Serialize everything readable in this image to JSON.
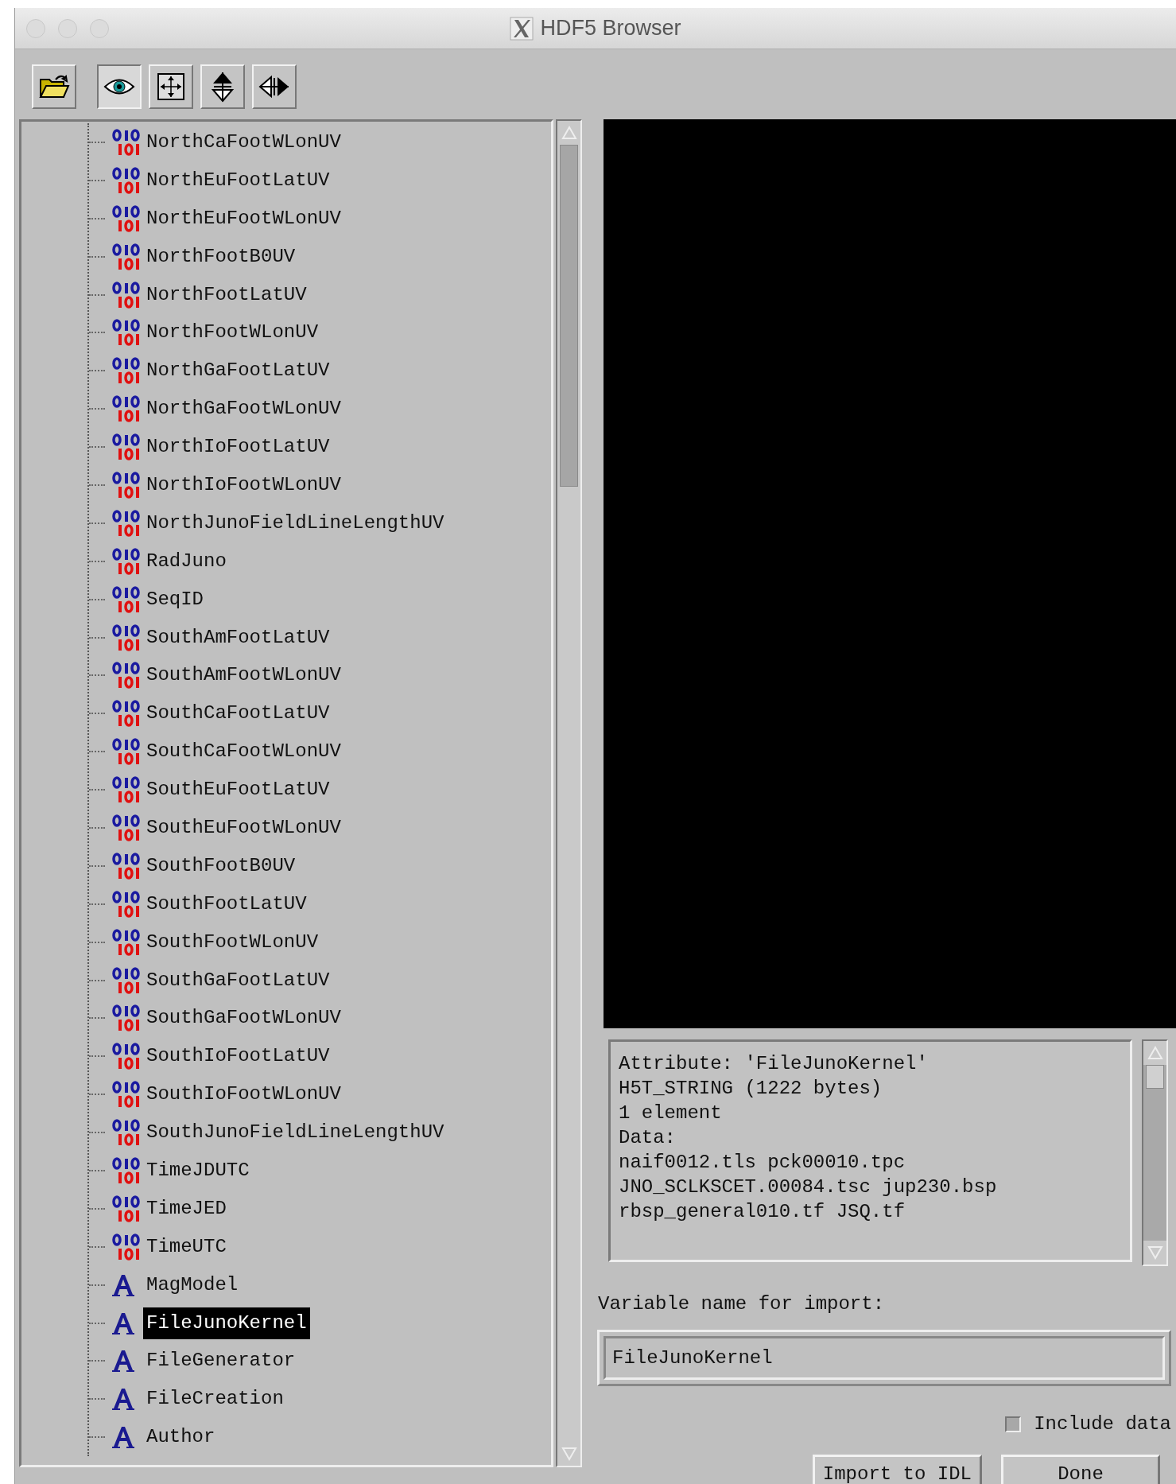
{
  "window": {
    "title": "HDF5 Browser"
  },
  "toolbar": [
    {
      "kind": "open",
      "selected": false
    },
    {
      "kind": "eye",
      "selected": true
    },
    {
      "kind": "fit",
      "selected": false
    },
    {
      "kind": "updown",
      "selected": false
    },
    {
      "kind": "leftright",
      "selected": false
    }
  ],
  "tree": {
    "items": [
      {
        "kind": "dataset",
        "label": "NorthCaFootWLonUV",
        "selected": false
      },
      {
        "kind": "dataset",
        "label": "NorthEuFootLatUV",
        "selected": false
      },
      {
        "kind": "dataset",
        "label": "NorthEuFootWLonUV",
        "selected": false
      },
      {
        "kind": "dataset",
        "label": "NorthFootB0UV",
        "selected": false
      },
      {
        "kind": "dataset",
        "label": "NorthFootLatUV",
        "selected": false
      },
      {
        "kind": "dataset",
        "label": "NorthFootWLonUV",
        "selected": false
      },
      {
        "kind": "dataset",
        "label": "NorthGaFootLatUV",
        "selected": false
      },
      {
        "kind": "dataset",
        "label": "NorthGaFootWLonUV",
        "selected": false
      },
      {
        "kind": "dataset",
        "label": "NorthIoFootLatUV",
        "selected": false
      },
      {
        "kind": "dataset",
        "label": "NorthIoFootWLonUV",
        "selected": false
      },
      {
        "kind": "dataset",
        "label": "NorthJunoFieldLineLengthUV",
        "selected": false
      },
      {
        "kind": "dataset",
        "label": "RadJuno",
        "selected": false
      },
      {
        "kind": "dataset",
        "label": "SeqID",
        "selected": false
      },
      {
        "kind": "dataset",
        "label": "SouthAmFootLatUV",
        "selected": false
      },
      {
        "kind": "dataset",
        "label": "SouthAmFootWLonUV",
        "selected": false
      },
      {
        "kind": "dataset",
        "label": "SouthCaFootLatUV",
        "selected": false
      },
      {
        "kind": "dataset",
        "label": "SouthCaFootWLonUV",
        "selected": false
      },
      {
        "kind": "dataset",
        "label": "SouthEuFootLatUV",
        "selected": false
      },
      {
        "kind": "dataset",
        "label": "SouthEuFootWLonUV",
        "selected": false
      },
      {
        "kind": "dataset",
        "label": "SouthFootB0UV",
        "selected": false
      },
      {
        "kind": "dataset",
        "label": "SouthFootLatUV",
        "selected": false
      },
      {
        "kind": "dataset",
        "label": "SouthFootWLonUV",
        "selected": false
      },
      {
        "kind": "dataset",
        "label": "SouthGaFootLatUV",
        "selected": false
      },
      {
        "kind": "dataset",
        "label": "SouthGaFootWLonUV",
        "selected": false
      },
      {
        "kind": "dataset",
        "label": "SouthIoFootLatUV",
        "selected": false
      },
      {
        "kind": "dataset",
        "label": "SouthIoFootWLonUV",
        "selected": false
      },
      {
        "kind": "dataset",
        "label": "SouthJunoFieldLineLengthUV",
        "selected": false
      },
      {
        "kind": "dataset",
        "label": "TimeJDUTC",
        "selected": false
      },
      {
        "kind": "dataset",
        "label": "TimeJED",
        "selected": false
      },
      {
        "kind": "dataset",
        "label": "TimeUTC",
        "selected": false
      },
      {
        "kind": "attribute",
        "label": "MagModel",
        "selected": false
      },
      {
        "kind": "attribute",
        "label": "FileJunoKernel",
        "selected": true
      },
      {
        "kind": "attribute",
        "label": "FileGenerator",
        "selected": false
      },
      {
        "kind": "attribute",
        "label": "FileCreation",
        "selected": false
      },
      {
        "kind": "attribute",
        "label": "Author",
        "selected": false
      }
    ]
  },
  "info": {
    "lines": [
      "Attribute: 'FileJunoKernel'",
      "H5T_STRING (1222 bytes)",
      "1 element",
      "Data:",
      "naif0012.tls pck00010.tpc",
      "JNO_SCLKSCET.00084.tsc jup230.bsp",
      "rbsp_general010.tf JSQ.tf"
    ]
  },
  "import": {
    "label": "Variable name for import:",
    "value": "FileJunoKernel"
  },
  "include_data": {
    "label": "Include data",
    "checked": false
  },
  "buttons": [
    "Import to IDL",
    "Done"
  ]
}
